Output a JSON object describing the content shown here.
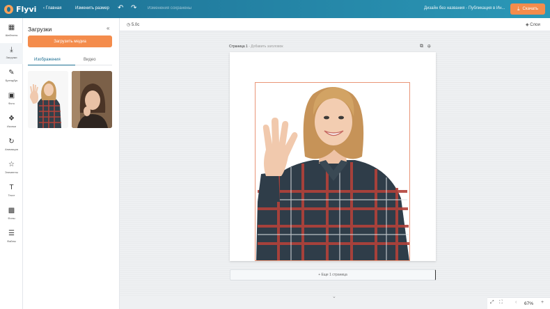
{
  "topbar": {
    "logo": "Flyvi",
    "back": "Главная",
    "resize": "Изменить размер",
    "saved": "Изменения сохранены",
    "document_title": "Дизайн без названия - Публикация в Ин...",
    "share": "Скачать"
  },
  "rail": {
    "items": [
      {
        "label": "Шаблоны",
        "icon": "templates-icon"
      },
      {
        "label": "Загрузки",
        "icon": "upload-icon"
      },
      {
        "label": "Брендбук",
        "icon": "brandbook-icon"
      },
      {
        "label": "Фото",
        "icon": "photo-icon"
      },
      {
        "label": "Иконки",
        "icon": "icons-icon"
      },
      {
        "label": "Анимация",
        "icon": "animation-icon"
      },
      {
        "label": "Элементы",
        "icon": "elements-icon"
      },
      {
        "label": "Текст",
        "icon": "text-icon"
      },
      {
        "label": "Фоны",
        "icon": "backgrounds-icon"
      },
      {
        "label": "Файлы",
        "icon": "files-icon"
      }
    ]
  },
  "panel": {
    "title": "Загрузки",
    "upload_button": "Загрузить медиа",
    "tab_images": "Изображения",
    "tab_video": "Видео"
  },
  "canvas": {
    "time": "5.0с",
    "layers": "Слои",
    "page_label": "Страница 1",
    "page_sub": "- Добавить заголовок",
    "add_page": "+ Еще 1 страница"
  },
  "zoom": {
    "value": "67%"
  },
  "colors": {
    "accent": "#f48c4c",
    "brand": "#1d6f93"
  }
}
